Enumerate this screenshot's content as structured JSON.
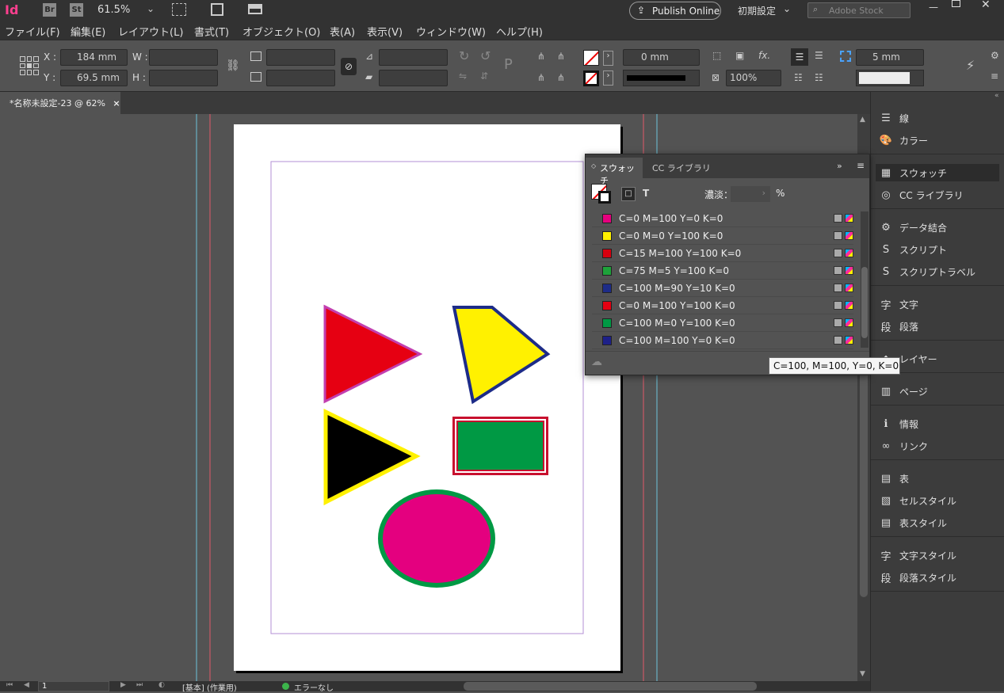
{
  "app": {
    "logo": "Id",
    "bridge": "Br",
    "stock_app": "St",
    "zoom": "61.5%",
    "publish_online": "Publish Online",
    "workspace": "初期設定",
    "search_placeholder": "Adobe Stock"
  },
  "menu": [
    "ファイル(F)",
    "編集(E)",
    "レイアウト(L)",
    "書式(T)",
    "オブジェクト(O)",
    "表(A)",
    "表示(V)",
    "ウィンドウ(W)",
    "ヘルプ(H)"
  ],
  "control": {
    "x_label": "X :",
    "x_value": "184 mm",
    "y_label": "Y :",
    "y_value": "69.5 mm",
    "w_label": "W :",
    "h_label": "H :",
    "stroke_weight": "0 mm",
    "opacity": "100%",
    "gap": "5 mm"
  },
  "document": {
    "tab_title": "*名称未設定-23 @ 62%"
  },
  "dock": {
    "items": [
      "線",
      "カラー",
      "スウォッチ",
      "CC ライブラリ",
      "データ結合",
      "スクリプト",
      "スクリプトラベル",
      "文字",
      "段落",
      "レイヤー",
      "ページ",
      "情報",
      "リンク",
      "表",
      "セルスタイル",
      "表スタイル",
      "文字スタイル",
      "段落スタイル"
    ]
  },
  "swatches_panel": {
    "tab_swatches": "スウォッチ",
    "tab_cc": "CC ライブラリ",
    "tint_label": "濃淡：",
    "tint_unit": "%",
    "rows": [
      {
        "name": "C=0 M=100 Y=0 K=0",
        "color": "#e6007e"
      },
      {
        "name": "C=0 M=0 Y=100 K=0",
        "color": "#fff100"
      },
      {
        "name": "C=15 M=100 Y=100 K=0",
        "color": "#d7000f"
      },
      {
        "name": "C=75 M=5 Y=100 K=0",
        "color": "#1ea23a"
      },
      {
        "name": "C=100 M=90 Y=10 K=0",
        "color": "#1d2c88"
      },
      {
        "name": "C=0 M=100 Y=100 K=0",
        "color": "#e60012"
      },
      {
        "name": "C=100 M=0 Y=100 K=0",
        "color": "#009944"
      },
      {
        "name": "C=100 M=100 Y=0 K=0",
        "color": "#1d2088"
      }
    ],
    "tooltip": "C=100, M=100, Y=0, K=0"
  },
  "status": {
    "page": "1",
    "master": "[基本] (作業用)",
    "preflight": "エラーなし"
  },
  "colors": {
    "shape_red": "#e60012",
    "shape_yellow": "#fff100",
    "shape_black": "#000000",
    "shape_green": "#009944",
    "shape_magenta": "#e4007f",
    "stroke_navy": "#1d2c88",
    "stroke_crimson": "#c8102e"
  }
}
